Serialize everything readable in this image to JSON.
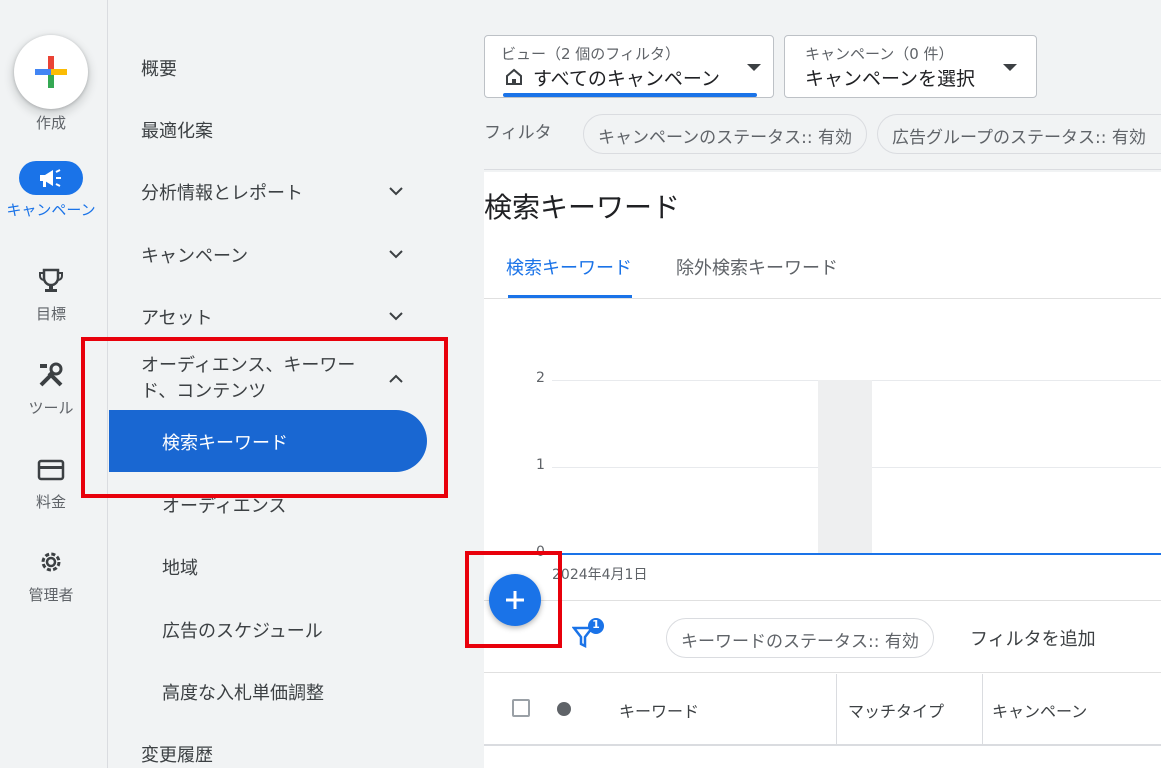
{
  "rail": {
    "create_label": "作成",
    "campaign_label": "キャンペーン",
    "goals_label": "目標",
    "tools_label": "ツール",
    "billing_label": "料金",
    "admin_label": "管理者",
    "accent": "#1a73e8"
  },
  "nav": {
    "overview": "概要",
    "recommendations": "最適化案",
    "insights": "分析情報とレポート",
    "campaigns": "キャンペーン",
    "assets": "アセット",
    "audiences_line1": "オーディエンス、キーワー",
    "audiences_line2": "ド、コンテンツ",
    "search_keywords": "検索キーワード",
    "audiences": "オーディエンス",
    "locations": "地域",
    "ad_schedule": "広告のスケジュール",
    "advanced_bid": "高度な入札単価調整",
    "change_history": "変更履歴"
  },
  "header": {
    "view_label": "ビュー（2 個のフィルタ）",
    "view_value": "すべてのキャンペーン",
    "campaign_label": "キャンペーン（0 件）",
    "campaign_value": "キャンペーンを選択",
    "filter_label": "フィルタ",
    "chip_campaign_status": "キャンペーンのステータス:: 有効",
    "chip_adgroup_status": "広告グループのステータス:: 有効"
  },
  "page": {
    "title": "検索キーワード",
    "tab_keywords": "検索キーワード",
    "tab_negative": "除外検索キーワード"
  },
  "chart_data": {
    "type": "bar",
    "categories": [
      "2024年4月1日"
    ],
    "y_ticks": [
      "2",
      "1",
      "0"
    ],
    "ylim": [
      0,
      2
    ],
    "title": "",
    "xlabel": "",
    "ylabel": ""
  },
  "table": {
    "filter_badge": "1",
    "chip_keyword_status": "キーワードのステータス:: 有効",
    "add_filter": "フィルタを追加",
    "col_keyword": "キーワード",
    "col_match": "マッチタイプ",
    "col_campaign": "キャンペーン"
  }
}
